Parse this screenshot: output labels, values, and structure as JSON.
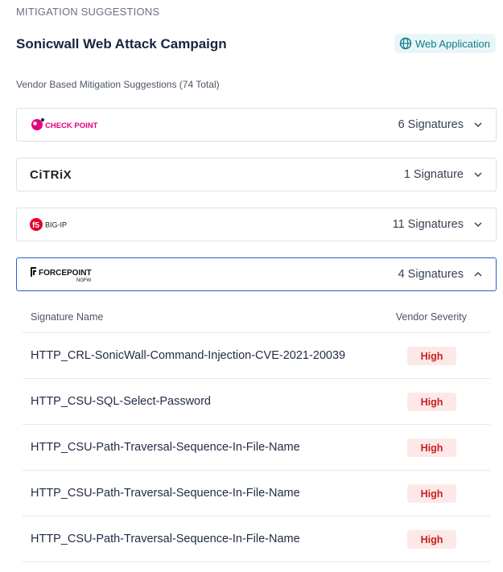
{
  "header": {
    "section_label": "MITIGATION SUGGESTIONS",
    "title": "Sonicwall Web Attack Campaign",
    "tag": {
      "label": "Web Application",
      "icon": "globe-icon",
      "color": "#0d7c86"
    }
  },
  "subheading": "Vendor Based Mitigation Suggestions (74 Total)",
  "vendors": [
    {
      "name": "CHECK POINT",
      "count_label": "6 Signatures",
      "expanded": false,
      "logo_color": "#e6007e"
    },
    {
      "name": "CiTRiX",
      "count_label": "1 Signature",
      "expanded": false,
      "logo_color": "#222222"
    },
    {
      "name": "BIG-IP",
      "count_label": "11 Signatures",
      "expanded": false,
      "logo_color": "#e4002b",
      "badge": "f5"
    },
    {
      "name": "FORCEPOINT",
      "sub": "NGFW",
      "count_label": "4 Signatures",
      "expanded": true,
      "logo_color": "#111111"
    }
  ],
  "table": {
    "columns": [
      "Signature Name",
      "Vendor Severity"
    ],
    "rows": [
      {
        "name": "HTTP_CRL-SonicWall-Command-Injection-CVE-2021-20039",
        "severity": "High"
      },
      {
        "name": "HTTP_CSU-SQL-Select-Password",
        "severity": "High"
      },
      {
        "name": "HTTP_CSU-Path-Traversal-Sequence-In-File-Name",
        "severity": "High"
      },
      {
        "name": "HTTP_CSU-Path-Traversal-Sequence-In-File-Name",
        "severity": "High"
      },
      {
        "name": "HTTP_CSU-Path-Traversal-Sequence-In-File-Name",
        "severity": "High"
      }
    ]
  },
  "colors": {
    "accent": "#2563c9",
    "severity_high_bg": "#fde8e8",
    "severity_high_text": "#c81e1e"
  }
}
